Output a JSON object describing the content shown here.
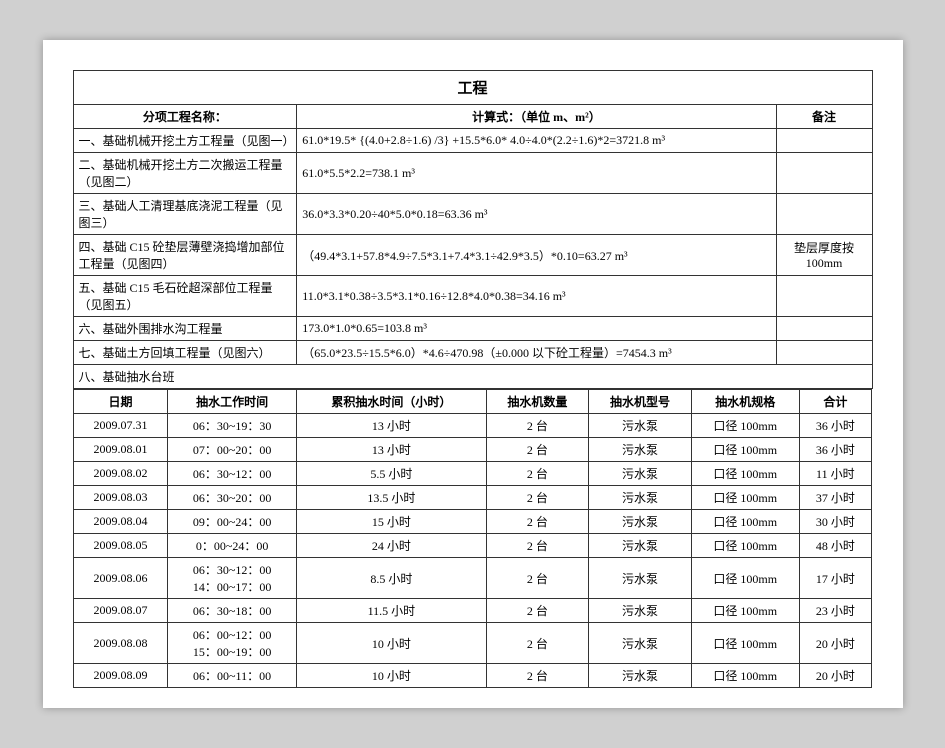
{
  "page": {
    "title": "工程",
    "headers": {
      "col1": "分项工程名称：",
      "col2": "计算式：（单位 m、m²）",
      "col3": "备注"
    },
    "rows": [
      {
        "label": "一、基础机械开挖土方工程量（见图一）",
        "formula": "61.0*19.5* {(4.0+2.8÷1.6) /3} +15.5*6.0* 4.0÷4.0*(2.2÷1.6)*2=3721.8 m³",
        "note": ""
      },
      {
        "label": "二、基础机械开挖土方二次搬运工程量（见图二）",
        "formula": "61.0*5.5*2.2=738.1 m³",
        "note": ""
      },
      {
        "label": "三、基础人工清理基底浇泥工程量（见图三）",
        "formula": "36.0*3.3*0.20÷40*5.0*0.18=63.36 m³",
        "note": ""
      },
      {
        "label": "四、基础 C15 砼垫层薄壁浇捣增加部位工程量（见图四）",
        "formula": "（49.4*3.1+57.8*4.9÷7.5*3.1+7.4*3.1÷42.9*3.5）*0.10=63.27 m³",
        "note": "垫层厚度按 100mm"
      },
      {
        "label": "五、基础 C15 毛石砼超深部位工程量（见图五）",
        "formula": "11.0*3.1*0.38÷3.5*3.1*0.16÷12.8*4.0*0.38=34.16 m³",
        "note": ""
      },
      {
        "label": "六、基础外围排水沟工程量",
        "formula": "173.0*1.0*0.65=103.8 m³",
        "note": ""
      },
      {
        "label": "七、基础土方回填工程量（见图六）",
        "formula": "（65.0*23.5÷15.5*6.0）*4.6÷470.98（±0.000 以下砼工程量）=7454.3 m³",
        "note": ""
      },
      {
        "label": "八、基础抽水台班",
        "formula": "",
        "note": ""
      }
    ],
    "pump_table": {
      "headers": [
        "日期",
        "抽水工作时间",
        "累积抽水时间（小时）",
        "抽水机数量",
        "抽水机型号",
        "抽水机规格",
        "合计"
      ],
      "rows": [
        {
          "date": "2009.07.31",
          "time": "06：30~19：30",
          "accumulated": "13 小时",
          "quantity": "2 台",
          "model": "污水泵",
          "spec": "口径 100mm",
          "total": "36 小时"
        },
        {
          "date": "2009.08.01",
          "time": "07：00~20：00",
          "accumulated": "13 小时",
          "quantity": "2 台",
          "model": "污水泵",
          "spec": "口径 100mm",
          "total": "36 小时"
        },
        {
          "date": "2009.08.02",
          "time": "06：30~12：00",
          "accumulated": "5.5 小时",
          "quantity": "2 台",
          "model": "污水泵",
          "spec": "口径 100mm",
          "total": "11 小时"
        },
        {
          "date": "2009.08.03",
          "time": "06：30~20：00",
          "accumulated": "13.5 小时",
          "quantity": "2 台",
          "model": "污水泵",
          "spec": "口径 100mm",
          "total": "37 小时"
        },
        {
          "date": "2009.08.04",
          "time": "09：00~24：00",
          "accumulated": "15 小时",
          "quantity": "2 台",
          "model": "污水泵",
          "spec": "口径 100mm",
          "total": "30 小时"
        },
        {
          "date": "2009.08.05",
          "time": "0：00~24：00",
          "accumulated": "24 小时",
          "quantity": "2 台",
          "model": "污水泵",
          "spec": "口径 100mm",
          "total": "48 小时"
        },
        {
          "date": "2009.08.06",
          "time_line1": "06：30~12：00",
          "time_line2": "14：00~17：00",
          "accumulated": "8.5 小时",
          "quantity": "2 台",
          "model": "污水泵",
          "spec": "口径 100mm",
          "total": "17 小时"
        },
        {
          "date": "2009.08.07",
          "time": "06：30~18：00",
          "accumulated": "11.5 小时",
          "quantity": "2 台",
          "model": "污水泵",
          "spec": "口径 100mm",
          "total": "23 小时"
        },
        {
          "date": "2009.08.08",
          "time_line1": "06：00~12：00",
          "time_line2": "15：00~19：00",
          "accumulated": "10 小时",
          "quantity": "2 台",
          "model": "污水泵",
          "spec": "口径 100mm",
          "total": "20 小时"
        },
        {
          "date": "2009.08.09",
          "time": "06：00~11：00",
          "accumulated": "10 小时",
          "quantity": "2 台",
          "model": "污水泵",
          "spec": "口径 100mm",
          "total": "20 小时"
        }
      ]
    }
  }
}
